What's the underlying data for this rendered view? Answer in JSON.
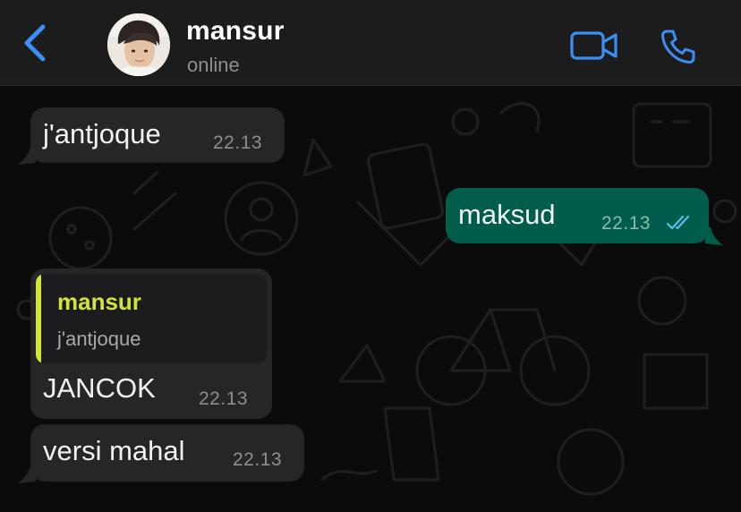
{
  "header": {
    "contact_name": "mansur",
    "status": "online",
    "accent_color": "#3a8ff5"
  },
  "icons": {
    "back": "chevron-left-icon",
    "video": "video-camera-icon",
    "call": "phone-icon",
    "read_receipt": "double-check-icon"
  },
  "messages": [
    {
      "direction": "incoming",
      "text": "j'antjoque",
      "time": "22.13"
    },
    {
      "direction": "outgoing",
      "text": "maksud",
      "time": "22.13",
      "status": "read"
    },
    {
      "direction": "incoming",
      "text": "JANCOK",
      "time": "22.13",
      "reply_to": {
        "author": "mansur",
        "text": "j'antjoque"
      }
    },
    {
      "direction": "incoming",
      "text": "versi mahal",
      "time": "22.13"
    }
  ],
  "colors": {
    "incoming_bubble": "#262628",
    "outgoing_bubble": "#005c4b",
    "quote_accent": "#d2e33a",
    "read_ticks": "#53bdeb"
  }
}
